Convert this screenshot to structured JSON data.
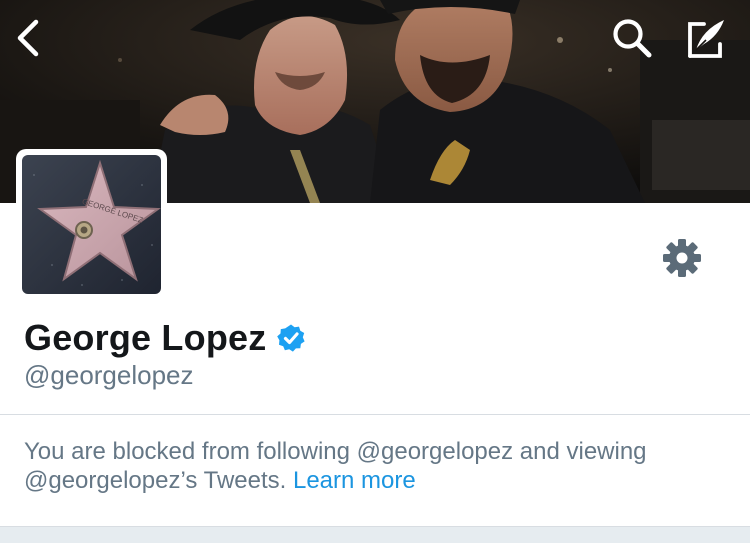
{
  "header": {
    "back_icon": "chevron-left-icon",
    "search_icon": "search-icon",
    "compose_icon": "compose-tweet-icon"
  },
  "avatar": {
    "star_text": "GEORGE LOPEZ"
  },
  "profile": {
    "name": "George Lopez",
    "handle": "@georgelopez",
    "verified": true,
    "verified_color": "#1da1f2"
  },
  "settings": {
    "icon": "gear-icon"
  },
  "blocked_notice": {
    "message": "You are blocked from following @georgelopez and viewing @georgelopez’s Tweets.",
    "link_label": "Learn more",
    "link_color": "#1b95e0"
  },
  "colors": {
    "name": "#14171a",
    "secondary_text": "#657786",
    "divider": "#d8dde2",
    "gear": "#5b6b78"
  }
}
